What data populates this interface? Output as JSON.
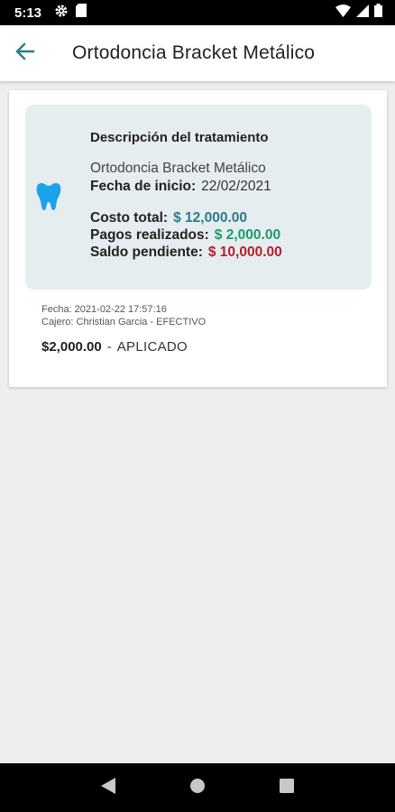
{
  "status_bar": {
    "time": "5:13",
    "icons": [
      "gear-icon",
      "sd-card-icon",
      "wifi-icon",
      "signal-icon",
      "battery-icon"
    ]
  },
  "app_bar": {
    "title": "Ortodoncia Bracket Metálico",
    "back_icon": "arrow-left-icon",
    "accent_color": "#2b7c8a"
  },
  "treatment": {
    "icon": "tooth-icon",
    "icon_color": "#1aa3e8",
    "heading": "Descripción del tratamiento",
    "name": "Ortodoncia Bracket Metálico",
    "start_date_label": "Fecha de inicio:",
    "start_date": "22/02/2021",
    "total_label": "Costo total:",
    "total": "$ 12,000.00",
    "paid_label": "Pagos realizados:",
    "paid": "$ 2,000.00",
    "balance_label": "Saldo pendiente:",
    "balance": "$ 10,000.00",
    "colors": {
      "total": "#2b7c8a",
      "paid": "#1e9a6a",
      "balance": "#b3202a"
    }
  },
  "payment": {
    "date_line": "Fecha: 2021-02-22 17:57:16",
    "cashier_line": "Cajero: Christian Garcia - EFECTIVO",
    "amount": "$2,000.00",
    "separator": "-",
    "status": "APLICADO"
  },
  "nav_bar": {
    "icons": [
      "back-triangle-icon",
      "home-circle-icon",
      "recents-square-icon"
    ]
  }
}
